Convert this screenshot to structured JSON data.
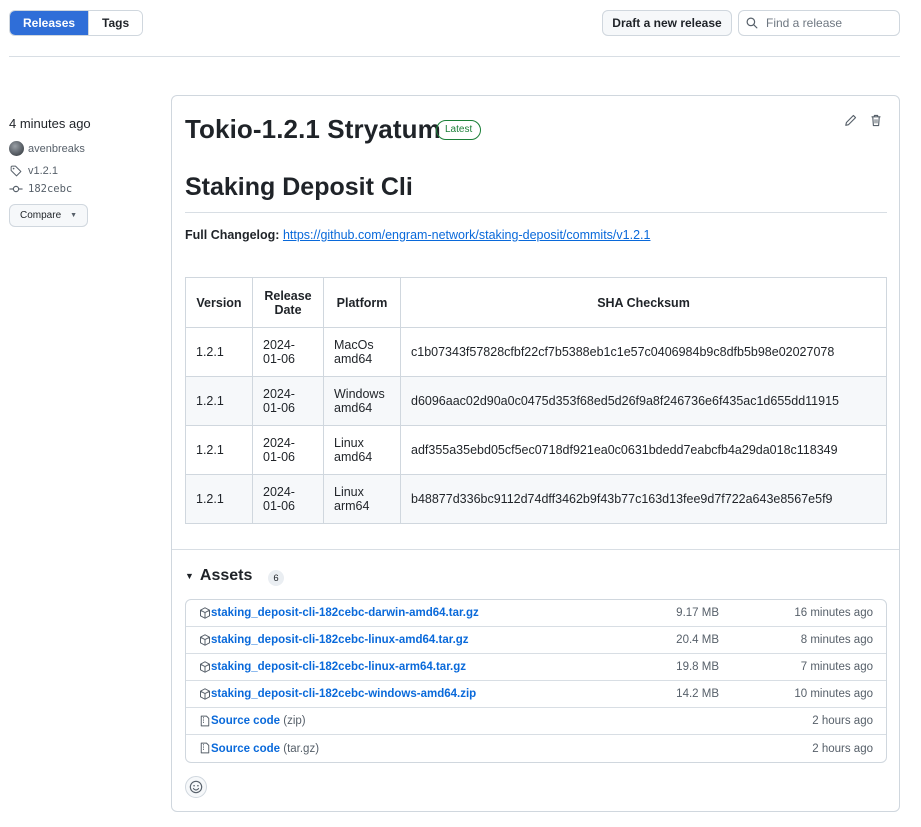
{
  "header": {
    "tabs": [
      {
        "label": "Releases",
        "active": true
      },
      {
        "label": "Tags",
        "active": false
      }
    ],
    "draft_button": "Draft a new release",
    "search_placeholder": "Find a release"
  },
  "sidebar": {
    "time_ago": "4 minutes ago",
    "author": "avenbreaks",
    "tag": "v1.2.1",
    "commit": "182cebc",
    "compare_label": "Compare"
  },
  "release": {
    "title": "Tokio-1.2.1 Stryatum",
    "badge": "Latest",
    "heading": "Staking Deposit Cli",
    "changelog_label": "Full Changelog",
    "changelog_url": "https://github.com/engram-network/staking-deposit/commits/v1.2.1",
    "table": {
      "headers": [
        "Version",
        "Release Date",
        "Platform",
        "SHA Checksum"
      ],
      "rows": [
        {
          "version": "1.2.1",
          "date": "2024-01-06",
          "platform": "MacOs amd64",
          "sha": "c1b07343f57828cfbf22cf7b5388eb1c1e57c0406984b9c8dfb5b98e02027078"
        },
        {
          "version": "1.2.1",
          "date": "2024-01-06",
          "platform": "Windows amd64",
          "sha": "d6096aac02d90a0c0475d353f68ed5d26f9a8f246736e6f435ac1d655dd11915"
        },
        {
          "version": "1.2.1",
          "date": "2024-01-06",
          "platform": "Linux amd64",
          "sha": "adf355a35ebd05cf5ec0718df921ea0c0631bdedd7eabcfb4a29da018c118349"
        },
        {
          "version": "1.2.1",
          "date": "2024-01-06",
          "platform": "Linux arm64",
          "sha": "b48877d336bc9112d74dff3462b9f43b77c163d13fee9d7f722a643e8567e5f9"
        }
      ]
    },
    "assets": {
      "title": "Assets",
      "count": "6",
      "items": [
        {
          "name": "staking_deposit-cli-182cebc-darwin-amd64.tar.gz",
          "suffix": "",
          "size": "9.17 MB",
          "time": "16 minutes ago",
          "icon": "package-icon"
        },
        {
          "name": "staking_deposit-cli-182cebc-linux-amd64.tar.gz",
          "suffix": "",
          "size": "20.4 MB",
          "time": "8 minutes ago",
          "icon": "package-icon"
        },
        {
          "name": "staking_deposit-cli-182cebc-linux-arm64.tar.gz",
          "suffix": "",
          "size": "19.8 MB",
          "time": "7 minutes ago",
          "icon": "package-icon"
        },
        {
          "name": "staking_deposit-cli-182cebc-windows-amd64.zip",
          "suffix": "",
          "size": "14.2 MB",
          "time": "10 minutes ago",
          "icon": "package-icon"
        },
        {
          "name": "Source code",
          "suffix": "(zip)",
          "size": "",
          "time": "2 hours ago",
          "icon": "file-zip-icon"
        },
        {
          "name": "Source code",
          "suffix": "(tar.gz)",
          "size": "",
          "time": "2 hours ago",
          "icon": "file-zip-icon"
        }
      ]
    }
  },
  "colors": {
    "accent": "#2f6ed8",
    "link": "#0969da",
    "latest_badge": "#1a7f37",
    "border": "#d0d7de"
  }
}
